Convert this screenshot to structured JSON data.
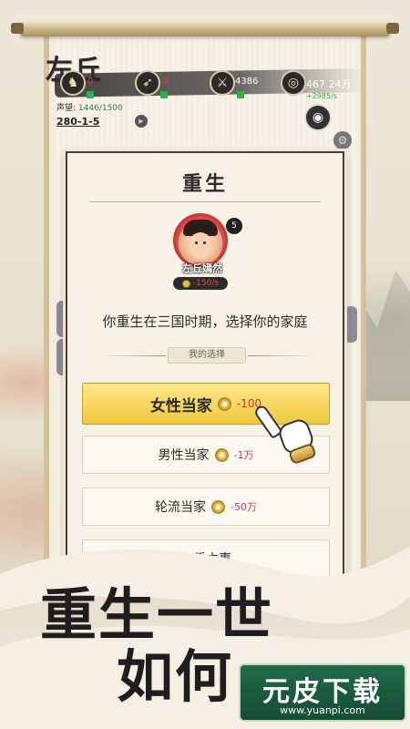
{
  "hud": {
    "player_name": "左丘",
    "stat1_value": "0",
    "stat2_value": "0",
    "power_value": "4386",
    "coins_value": "467.24万",
    "coins_income": "+2985/s",
    "reputation_label": "声望:",
    "reputation_value": "1446/1500",
    "stage": "280-1-5",
    "icons": [
      "horse-icon",
      "bow-icon",
      "sword-icon",
      "coin-icon",
      "eye-icon",
      "gear-icon"
    ]
  },
  "dialog": {
    "title": "重生",
    "character_name": "左丘嫣然",
    "character_level": "5",
    "character_cost": "-150/s",
    "question": "你重生在三国时期，选择你的家庭",
    "choice_label": "我的选择",
    "options": [
      {
        "label": "女性当家",
        "cost": "-100",
        "highlighted": true
      },
      {
        "label": "男性当家",
        "cost": "-1万",
        "highlighted": false
      },
      {
        "label": "轮流当家",
        "cost": "-50万",
        "highlighted": false
      },
      {
        "label": "各凭本事",
        "cost": "",
        "highlighted": false
      }
    ]
  },
  "slogan": {
    "line1": "重生一世",
    "line2": "如何"
  },
  "watermark": {
    "title": "元皮下载",
    "url": "www.yuanpi.com"
  },
  "colors": {
    "highlight_option": "#f0c93c",
    "cost_text": "#d6336c",
    "income_green": "#3ea845",
    "watermark_bg": "#1f6b4a"
  }
}
